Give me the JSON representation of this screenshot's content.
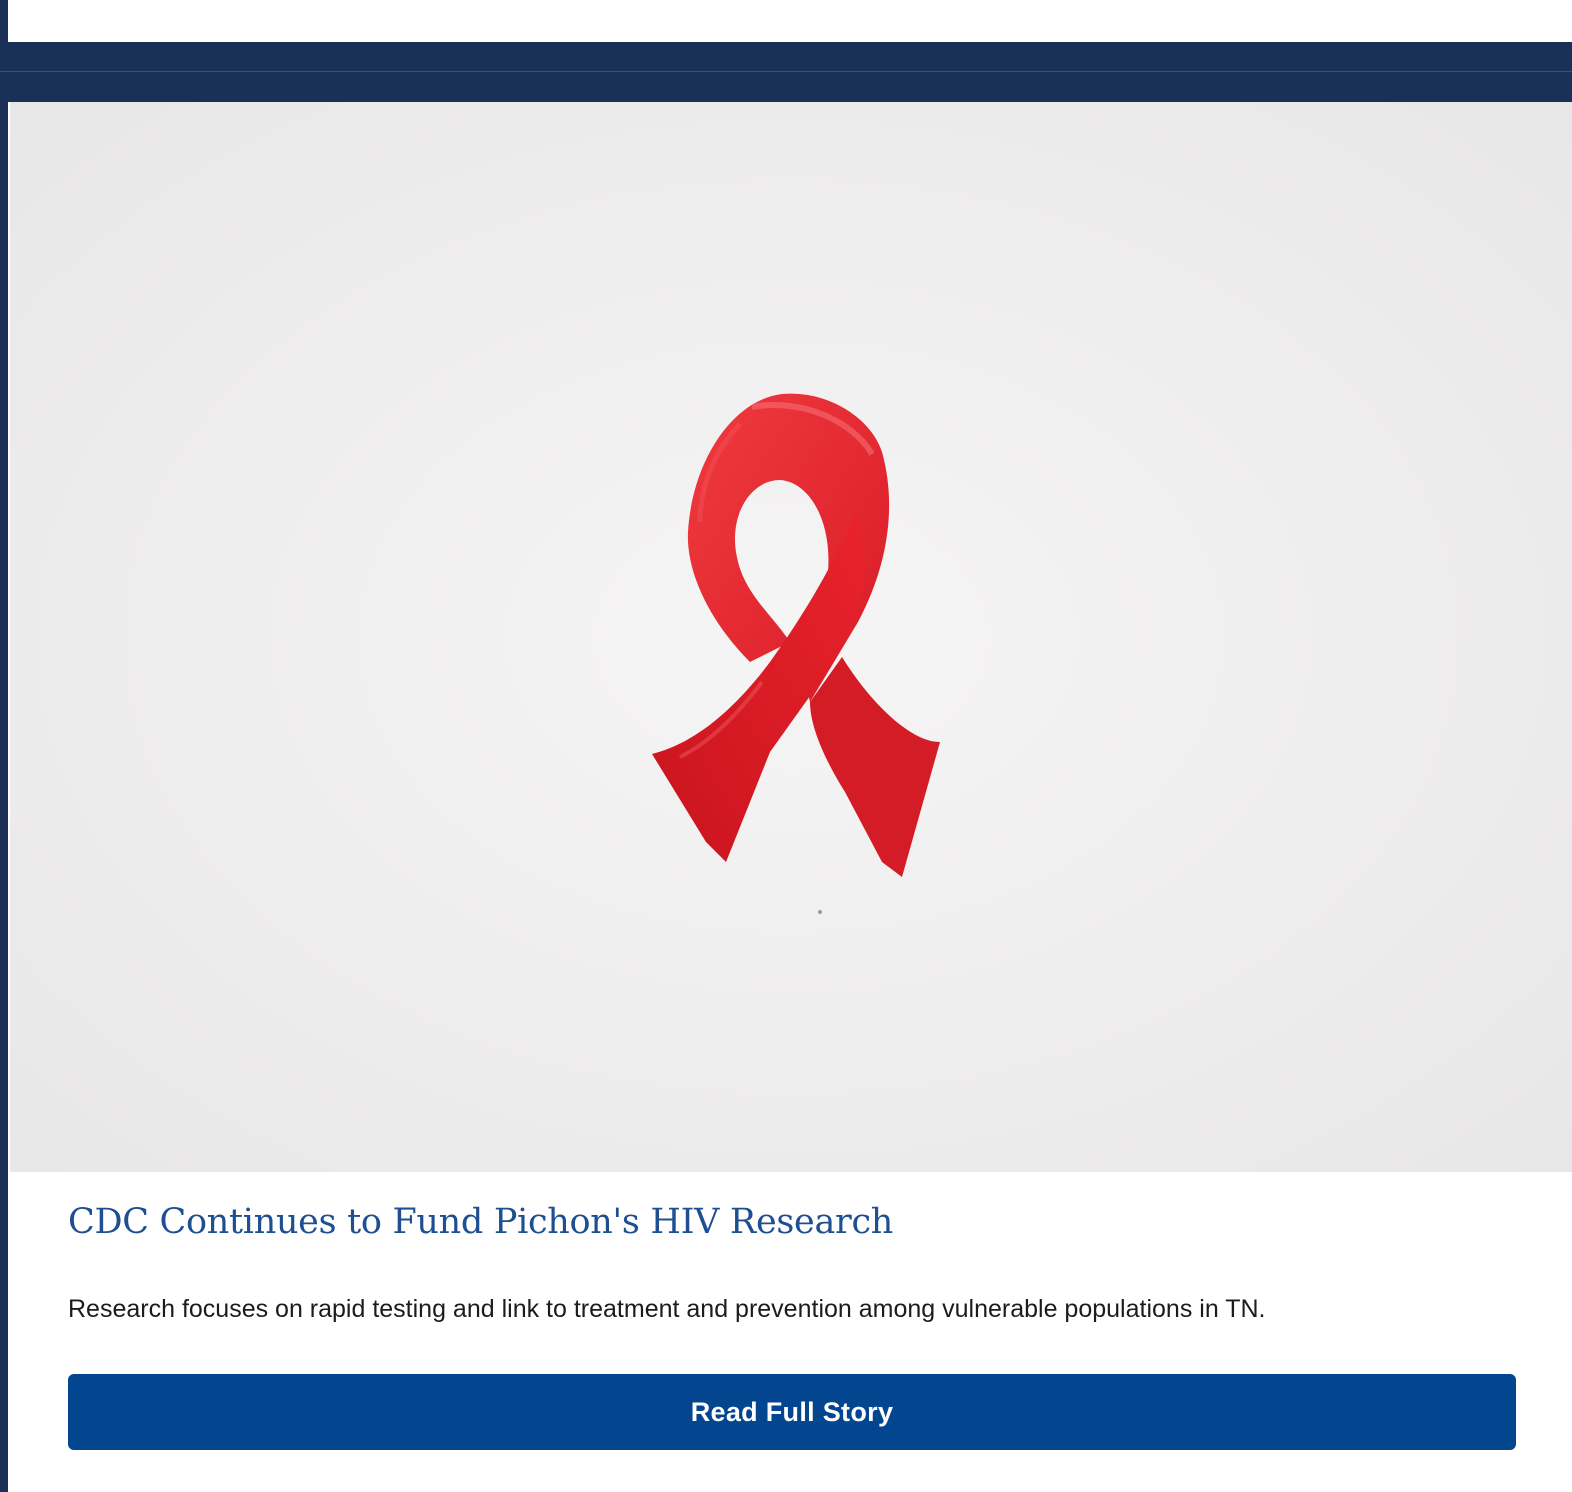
{
  "story": {
    "image_subject": "red-awareness-ribbon",
    "headline": "CDC Continues to Fund Pichon's HIV Research",
    "summary": "Research focuses on rapid testing and link to treatment and prevention among vulnerable populations in TN.",
    "cta_label": "Read Full Story"
  },
  "colors": {
    "nav_band": "#1b3057",
    "headline": "#1d4f91",
    "button": "#03458e",
    "ribbon": "#e5222b"
  }
}
